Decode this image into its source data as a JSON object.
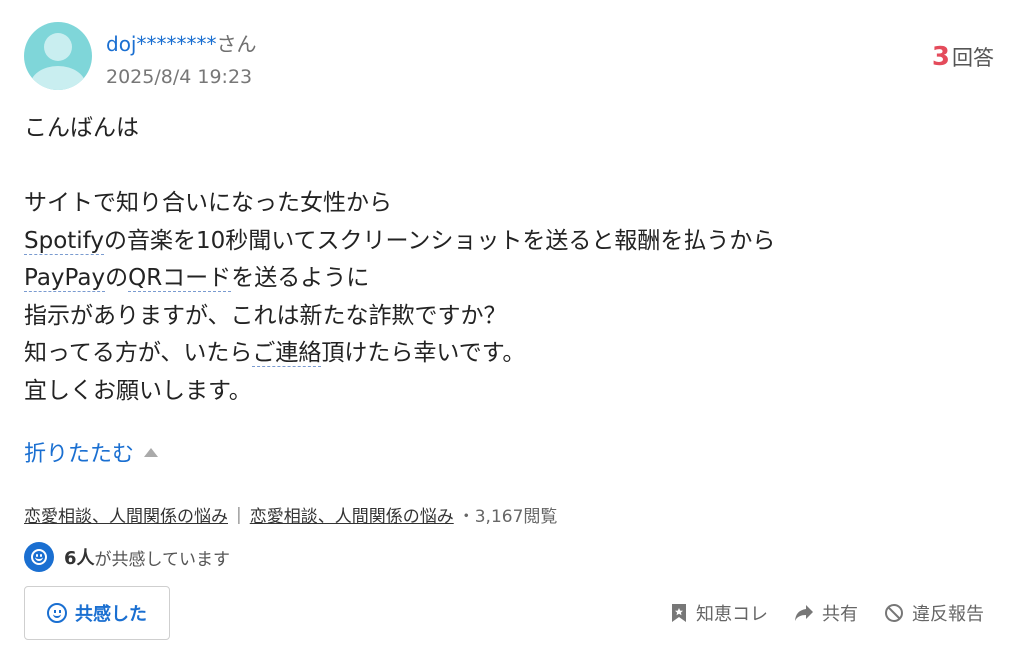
{
  "user": {
    "name": "doj********",
    "suffix": "さん",
    "date": "2025/8/4 19:23"
  },
  "answers": {
    "count": "3",
    "label": "回答"
  },
  "question": {
    "greeting": "こんばんは",
    "line1": "サイトで知り合いになった女性から",
    "line2_link": "Spotify",
    "line2_rest": "の音楽を10秒聞いてスクリーンショットを送ると報酬を払うから",
    "line3_link1": "PayPay",
    "line3_mid": "の",
    "line3_link2": "QRコード",
    "line3_rest": "を送るように",
    "line4": "指示がありますが、これは新たな詐欺ですか？",
    "line5_pre": "知ってる方が、いたら",
    "line5_link": "ご連絡",
    "line5_rest": "頂けたら幸いです。",
    "line6": "宜しくお願いします。"
  },
  "collapse_label": "折りたたむ",
  "categories": [
    "恋愛相談、人間関係の悩み",
    "恋愛相談、人間関係の悩み"
  ],
  "category_separator": "|",
  "views": "・3,167閲覧",
  "empathy": {
    "count": "6人",
    "text": "が共感しています",
    "button_label": "共感した"
  },
  "actions": {
    "save": "知恵コレ",
    "share": "共有",
    "report": "違反報告"
  },
  "colors": {
    "link": "#1a6fd1",
    "answer_count": "#e44b5b",
    "avatar": "#7fd6d9"
  },
  "icons": [
    "user-avatar-icon",
    "triangle-up-icon",
    "smile-icon",
    "bookmark-icon",
    "share-arrow-icon",
    "ban-icon"
  ]
}
